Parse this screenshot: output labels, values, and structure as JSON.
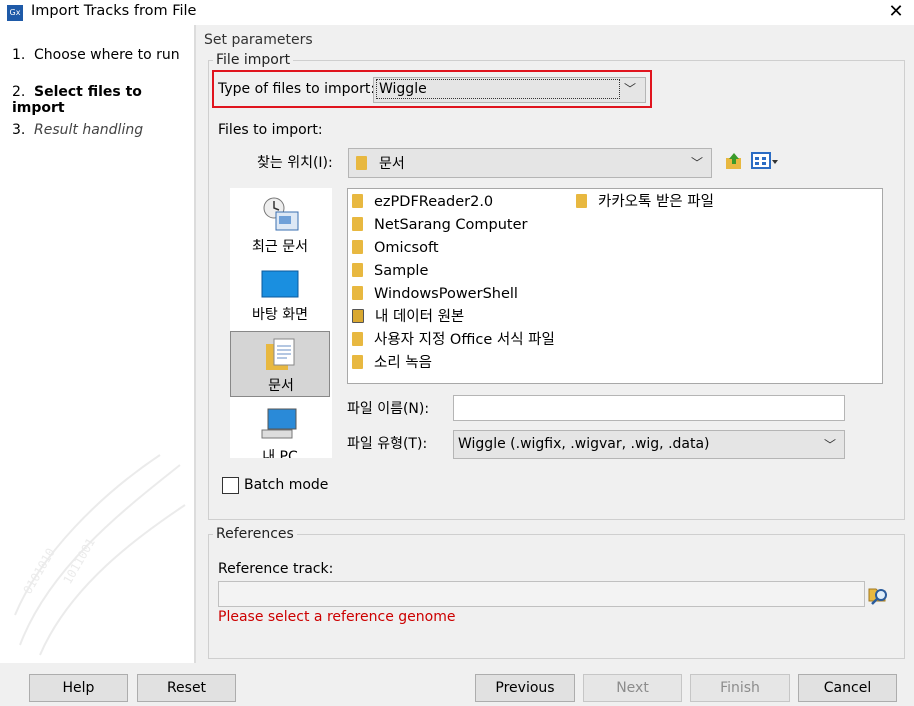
{
  "window": {
    "title": "Import Tracks from File",
    "app_icon": "Gx"
  },
  "steps": [
    {
      "num": "1.",
      "label": "Choose where to run"
    },
    {
      "num": "2.",
      "label": "Select files to import"
    },
    {
      "num": "3.",
      "label": "Result handling"
    }
  ],
  "section_title": "Set parameters",
  "file_import": {
    "legend": "File import",
    "type_label": "Type of files to import:",
    "type_value": "Wiggle",
    "files_label": "Files to import:",
    "look_in_label": "찾는 위치(I):",
    "look_in_value": "문서",
    "places": [
      {
        "label": "최근 문서",
        "icon": "recent-icon"
      },
      {
        "label": "바탕 화면",
        "icon": "desktop-icon"
      },
      {
        "label": "문서",
        "icon": "documents-icon"
      },
      {
        "label": "내 PC",
        "icon": "pc-icon"
      }
    ],
    "files_col1": [
      "ezPDFReader2.0",
      "NetSarang Computer",
      "Omicsoft",
      "Sample",
      "WindowsPowerShell",
      "내 데이터 원본",
      "사용자 지정 Office 서식 파일",
      "소리 녹음"
    ],
    "files_col2": [
      "카카오톡 받은 파일"
    ],
    "filename_label": "파일 이름(N):",
    "filename_value": "",
    "filetype_label": "파일 유형(T):",
    "filetype_value": "Wiggle (.wigfix, .wigvar, .wig, .data)",
    "batch_label": "Batch mode"
  },
  "references": {
    "legend": "References",
    "track_label": "Reference track:",
    "track_value": "",
    "error": "Please select a reference genome"
  },
  "buttons": {
    "help": "Help",
    "reset": "Reset",
    "previous": "Previous",
    "next": "Next",
    "finish": "Finish",
    "cancel": "Cancel"
  },
  "colors": {
    "highlight": "#e0141e",
    "error": "#cc0000",
    "selected_place": "#d5d5d5"
  }
}
